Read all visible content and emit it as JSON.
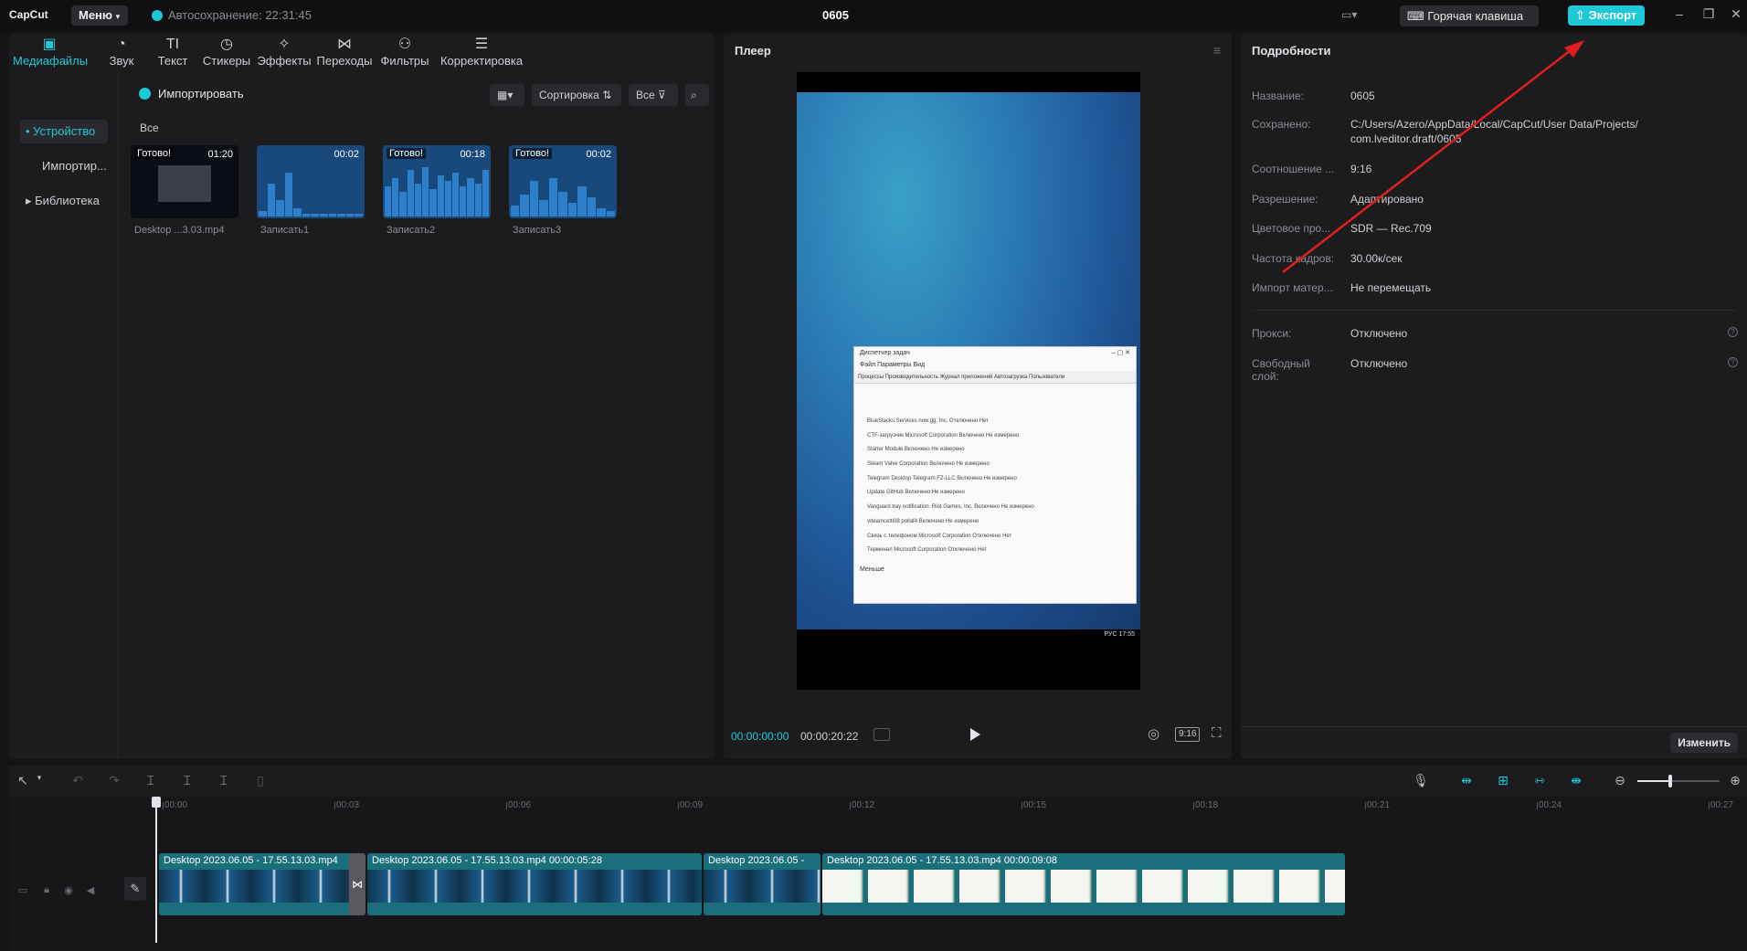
{
  "app": {
    "logo": "CapCut",
    "menu_label": "Меню",
    "autosave": "Автосохранение: 22:31:45",
    "project_title": "0605",
    "hotkey_label": "Горячая клавиша",
    "export_label": "Экспорт",
    "accent_color": "#1ec8d6"
  },
  "media": {
    "tabs": [
      {
        "label": "Медиафайлы",
        "icon": "media-icon"
      },
      {
        "label": "Звук",
        "icon": "audio-icon"
      },
      {
        "label": "Текст",
        "icon": "text-icon"
      },
      {
        "label": "Стикеры",
        "icon": "sticker-icon"
      },
      {
        "label": "Эффекты",
        "icon": "effects-icon"
      },
      {
        "label": "Переходы",
        "icon": "transitions-icon"
      },
      {
        "label": "Фильтры",
        "icon": "filters-icon"
      },
      {
        "label": "Корректировка",
        "icon": "adjust-icon"
      }
    ],
    "sidebar": [
      "Устройство",
      "Импортир...",
      "Библиотека"
    ],
    "import_label": "Импортировать",
    "sort_label": "Сортировка",
    "filter_label": "Все",
    "all_label": "Все",
    "clips": [
      {
        "badge": "Готово!",
        "duration": "01:20",
        "name": "Desktop ...3.03.mp4"
      },
      {
        "badge": "",
        "duration": "00:02",
        "name": "Записать1"
      },
      {
        "badge": "Готово!",
        "duration": "00:18",
        "name": "Записать2"
      },
      {
        "badge": "Готово!",
        "duration": "00:02",
        "name": "Записать3"
      }
    ]
  },
  "player": {
    "title": "Плеер",
    "current_time": "00:00:00:00",
    "total_time": "00:00:20:22",
    "ratio": "9:16",
    "taskmgr": {
      "title": "Диспетчер задач",
      "menu": "Файл   Параметры   Вид",
      "tabs": "Процессы  Производительность  Журнал приложений  Автозагрузка  Пользователи",
      "rows": [
        "BlueStacks Services     now.gg, Inc.           Отключено   Нет",
        "CTF-загрузчик           Microsoft Corporation  Включено    Не измерено",
        "Starter Module                                 Включено    Не измерено",
        "Steam                   Valve Corporation      Включено    Не измерено",
        "Telegram Desktop        Telegram FZ-LLC        Включено    Не измерено",
        "Update                  GitHub                 Включено    Не измерено",
        "Vanguard tray notification.  Riot Games, Inc.  Включено    Не измерено",
        "vdeamcetti08            pollaf4                Включено    Не измерено",
        "Связь с телефоном       Microsoft Corporation  Отключено   Нет",
        "Терминал                Microsoft Corporation  Отключено   Нет"
      ],
      "footer": "Меньше"
    },
    "taskbar_text": "РУС  17:55"
  },
  "details": {
    "title": "Подробности",
    "rows": [
      {
        "label": "Название:",
        "value": "0605"
      },
      {
        "label": "Сохранено:",
        "value": "C:/Users/Azero/AppData/Local/CapCut/User Data/Projects/",
        "value2": "com.lveditor.draft/0605"
      },
      {
        "label": "Соотношение ...",
        "value": "9:16"
      },
      {
        "label": "Разрешение:",
        "value": "Адаптировано"
      },
      {
        "label": "Цветовое про...",
        "value": "SDR — Rec.709"
      },
      {
        "label": "Частота кадров:",
        "value": "30.00к/сек"
      },
      {
        "label": "Импорт матер...",
        "value": "Не перемещать"
      }
    ],
    "proxy_label": "Прокси:",
    "proxy_value": "Отключено",
    "free_layer_label": "Свободный слой:",
    "free_layer_value": "Отключено",
    "edit_label": "Изменить"
  },
  "timeline": {
    "ticks": [
      "00:00",
      "00:03",
      "00:06",
      "00:09",
      "00:12",
      "00:15",
      "00:18",
      "00:21",
      "00:24",
      "00:27"
    ],
    "clips": [
      {
        "label": "Desktop 2023.06.05 - 17.55.13.03.mp4",
        "style": "dark"
      },
      {
        "label": "Desktop 2023.06.05 - 17.55.13.03.mp4   00:00:05:28",
        "style": "dark"
      },
      {
        "label": "Desktop 2023.06.05 -",
        "style": "dark"
      },
      {
        "label": "Desktop 2023.06.05 - 17.55.13.03.mp4   00:00:09:08",
        "style": "light"
      }
    ],
    "zoom_level": 0.4
  }
}
